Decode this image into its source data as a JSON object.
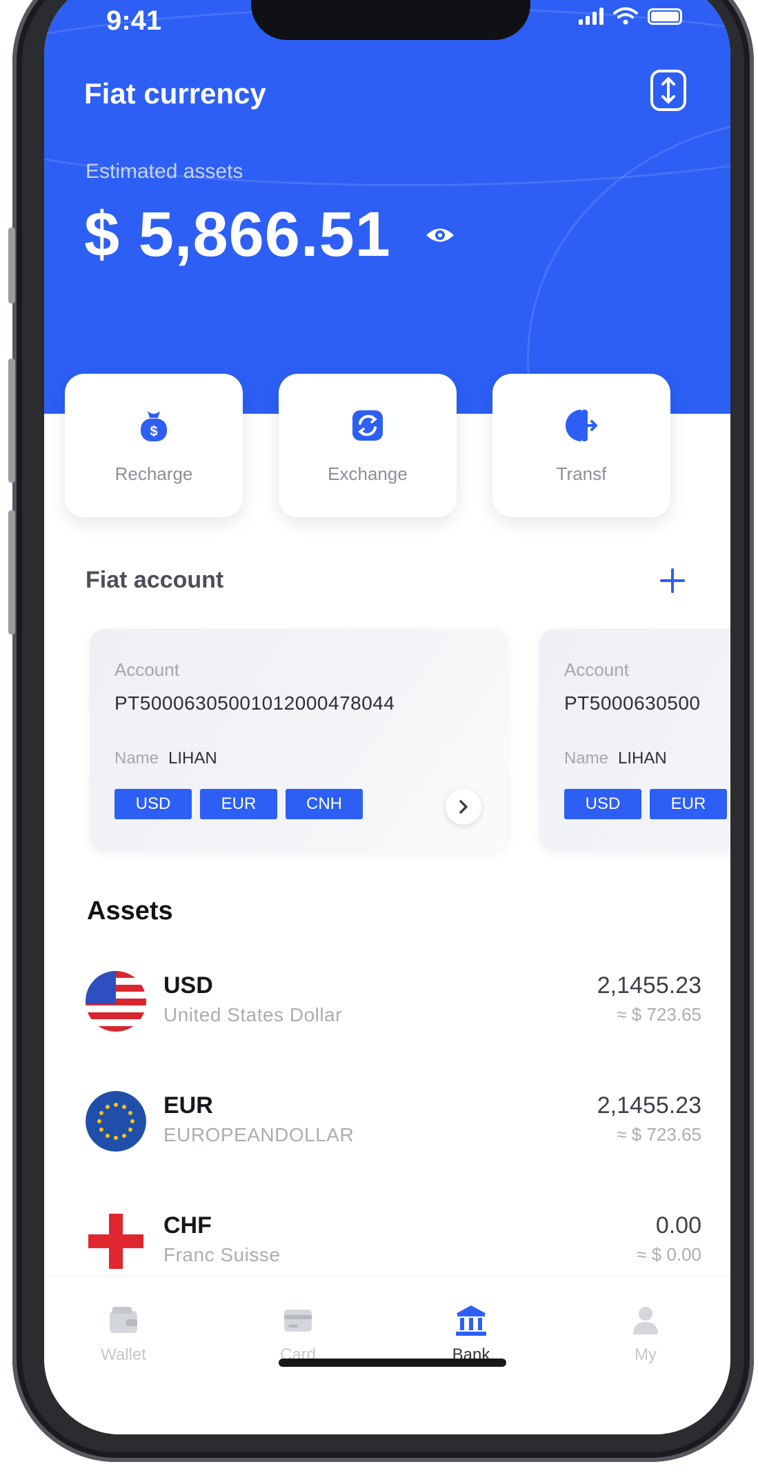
{
  "status": {
    "time": "9:41"
  },
  "header": {
    "title": "Fiat currency",
    "estimated_label": "Estimated assets",
    "estimated_value": "$ 5,866.51"
  },
  "actions": [
    {
      "label": "Recharge",
      "icon": "moneybag-icon"
    },
    {
      "label": "Exchange",
      "icon": "exchange-icon"
    },
    {
      "label": "Transf",
      "icon": "transfer-icon"
    }
  ],
  "fiat_account": {
    "title": "Fiat account",
    "cards": [
      {
        "account_label": "Account",
        "account_number": "PT50006305001012000478044",
        "name_label": "Name",
        "name_value": "LIHAN",
        "currencies": [
          "USD",
          "EUR",
          "CNH"
        ]
      },
      {
        "account_label": "Account",
        "account_number": "PT5000630500",
        "name_label": "Name",
        "name_value": "LIHAN",
        "currencies": [
          "USD",
          "EUR"
        ]
      }
    ]
  },
  "assets": {
    "title": "Assets",
    "items": [
      {
        "code": "USD",
        "name": "United States Dollar",
        "amount": "2,1455.23",
        "fiat": "≈ $ 723.65"
      },
      {
        "code": "EUR",
        "name": "EUROPEANDOLLAR",
        "amount": "2,1455.23",
        "fiat": "≈ $ 723.65"
      },
      {
        "code": "CHF",
        "name": "Franc Suisse",
        "amount": "0.00",
        "fiat": "≈ $ 0.00"
      }
    ]
  },
  "tabbar": {
    "items": [
      {
        "label": "Wallet",
        "icon": "wallet-icon"
      },
      {
        "label": "Card",
        "icon": "card-icon"
      },
      {
        "label": "Bank",
        "icon": "bank-icon",
        "active": true
      },
      {
        "label": "My",
        "icon": "person-icon"
      }
    ]
  },
  "colors": {
    "accent": "#2d5ff5",
    "background": "#ffffff"
  }
}
